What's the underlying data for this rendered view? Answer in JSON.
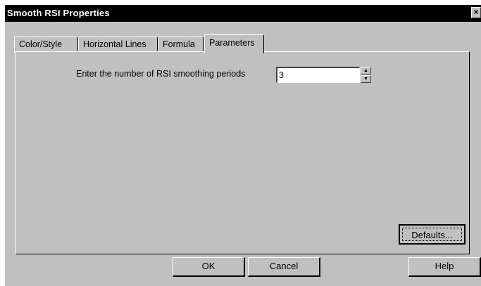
{
  "window": {
    "title": "Smooth RSI Properties",
    "close_glyph": "×"
  },
  "tabs": [
    {
      "label": "Color/Style",
      "active": false
    },
    {
      "label": "Horizontal Lines",
      "active": false
    },
    {
      "label": "Formula",
      "active": false
    },
    {
      "label": "Parameters",
      "active": true
    }
  ],
  "parameters": {
    "smoothing_label": "Enter the number of RSI smoothing periods",
    "smoothing_value": "3",
    "spin_up": "▲",
    "spin_down": "▼"
  },
  "buttons": {
    "defaults_label": "Defaults...",
    "ok_label": "OK",
    "cancel_label": "Cancel",
    "help_label": "Help"
  },
  "icons": {
    "close": "close-icon",
    "spin_up": "spin-up-icon",
    "spin_down": "spin-down-icon"
  },
  "colors": {
    "title_bar": "#000000",
    "dialog_face": "#c0c0c0",
    "input_bg": "#ffffff"
  }
}
